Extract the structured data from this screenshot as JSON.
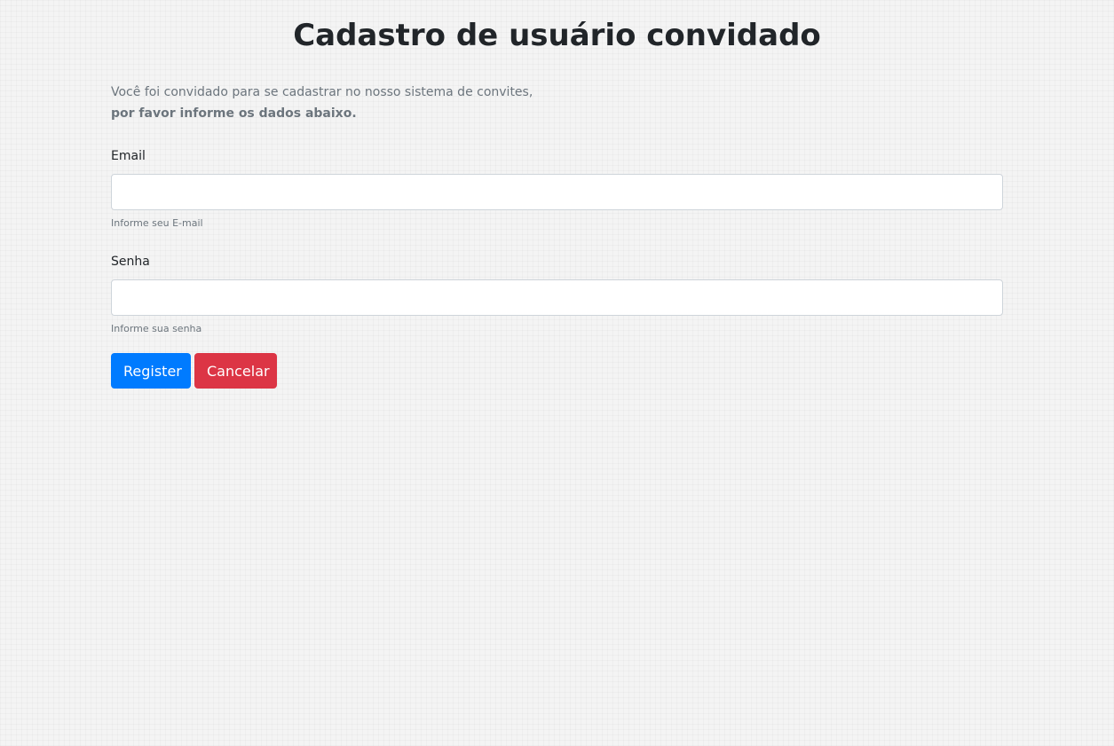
{
  "page": {
    "title": "Cadastro de usuário convidado"
  },
  "intro": {
    "line1": "Você foi convidado para se cadastrar no nosso sistema de convites,",
    "line2": "por favor informe os dados abaixo."
  },
  "form": {
    "email": {
      "label": "Email",
      "value": "",
      "help": "Informe seu E-mail"
    },
    "password": {
      "label": "Senha",
      "value": "",
      "help": "Informe sua senha"
    },
    "register_label": "Register",
    "cancel_label": "Cancelar"
  },
  "colors": {
    "primary": "#007bff",
    "danger": "#dc3545",
    "muted": "#6c757d",
    "background": "#f4f4f4"
  }
}
